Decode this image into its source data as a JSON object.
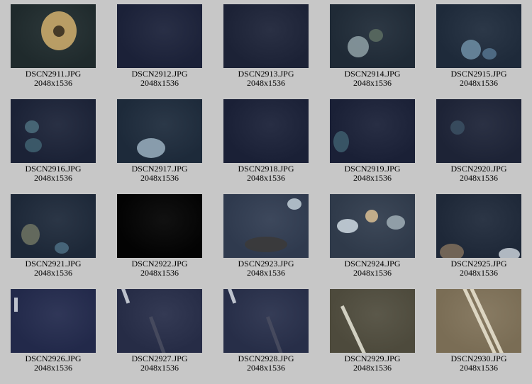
{
  "gallery": {
    "items": [
      {
        "filename": "DSCN2911.JPG",
        "dimensions": "2048x1536",
        "tone": "#1f2a2c"
      },
      {
        "filename": "DSCN2912.JPG",
        "dimensions": "2048x1536",
        "tone": "#1b2138"
      },
      {
        "filename": "DSCN2913.JPG",
        "dimensions": "2048x1536",
        "tone": "#1c2236"
      },
      {
        "filename": "DSCN2914.JPG",
        "dimensions": "2048x1536",
        "tone": "#1f2a36"
      },
      {
        "filename": "DSCN2915.JPG",
        "dimensions": "2048x1536",
        "tone": "#1e2a3a"
      },
      {
        "filename": "DSCN2916.JPG",
        "dimensions": "2048x1536",
        "tone": "#1b2236"
      },
      {
        "filename": "DSCN2917.JPG",
        "dimensions": "2048x1536",
        "tone": "#1d2a3a"
      },
      {
        "filename": "DSCN2918.JPG",
        "dimensions": "2048x1536",
        "tone": "#1a2036"
      },
      {
        "filename": "DSCN2919.JPG",
        "dimensions": "2048x1536",
        "tone": "#1a2036"
      },
      {
        "filename": "DSCN2920.JPG",
        "dimensions": "2048x1536",
        "tone": "#1d2336"
      },
      {
        "filename": "DSCN2921.JPG",
        "dimensions": "2048x1536",
        "tone": "#1d2838"
      },
      {
        "filename": "DSCN2922.JPG",
        "dimensions": "2048x1536",
        "tone": "#030303"
      },
      {
        "filename": "DSCN2923.JPG",
        "dimensions": "2048x1536",
        "tone": "#2f3a4e"
      },
      {
        "filename": "DSCN2924.JPG",
        "dimensions": "2048x1536",
        "tone": "#2f3a4a"
      },
      {
        "filename": "DSCN2925.JPG",
        "dimensions": "2048x1536",
        "tone": "#1e2838"
      },
      {
        "filename": "DSCN2926.JPG",
        "dimensions": "2048x1536",
        "tone": "#22294a"
      },
      {
        "filename": "DSCN2927.JPG",
        "dimensions": "2048x1536",
        "tone": "#262c46"
      },
      {
        "filename": "DSCN2928.JPG",
        "dimensions": "2048x1536",
        "tone": "#272e48"
      },
      {
        "filename": "DSCN2929.JPG",
        "dimensions": "2048x1536",
        "tone": "#4d4a3c"
      },
      {
        "filename": "DSCN2930.JPG",
        "dimensions": "2048x1536",
        "tone": "#7a6d55"
      }
    ]
  }
}
